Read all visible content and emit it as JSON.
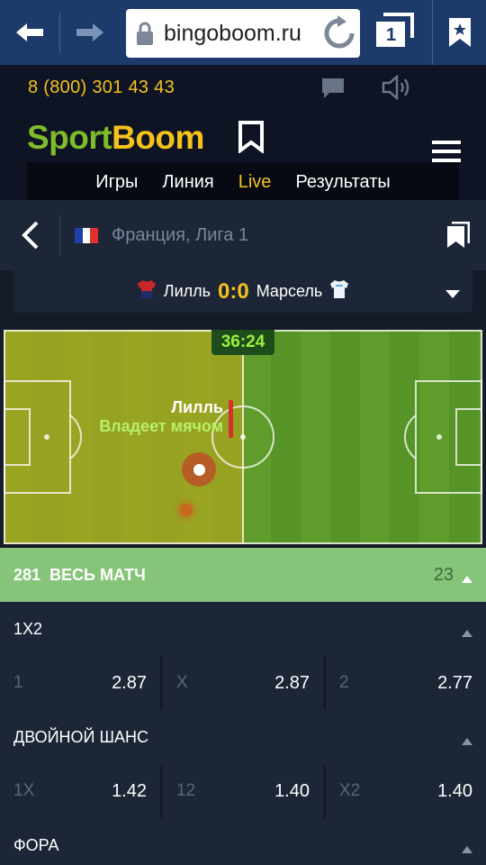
{
  "browser": {
    "url": "bingoboom.ru",
    "tab_count": "1"
  },
  "topbar": {
    "phone": "8 (800) 301 43 43"
  },
  "header": {
    "logo_part1": "Sport",
    "logo_part2": "Boom",
    "nav": [
      "Игры",
      "Линия",
      "Live",
      "Результаты"
    ],
    "active_nav": "Live"
  },
  "league": {
    "name": "Франция, Лига 1",
    "flag_colors": [
      "#1f3fa8",
      "#ffffff",
      "#e0312e"
    ]
  },
  "match": {
    "home_team": "Лилль",
    "away_team": "Марсель",
    "home_score": "0",
    "separator": ":",
    "away_score": "0",
    "time": "36:24",
    "possession_team": "Лилль",
    "possession_text": "Владеет мячом"
  },
  "markets": {
    "number": "281",
    "title": "ВЕСЬ МАТЧ",
    "count": "23",
    "groups": [
      {
        "title": "1X2",
        "odds": [
          {
            "label": "1",
            "value": "2.87"
          },
          {
            "label": "X",
            "value": "2.87"
          },
          {
            "label": "2",
            "value": "2.77"
          }
        ]
      },
      {
        "title": "ДВОЙНОЙ ШАНС",
        "odds": [
          {
            "label": "1X",
            "value": "1.42"
          },
          {
            "label": "12",
            "value": "1.40"
          },
          {
            "label": "X2",
            "value": "1.40"
          }
        ]
      },
      {
        "title": "ФОРА",
        "odds": []
      }
    ]
  },
  "colors": {
    "accent_yellow": "#f5c21b",
    "brand_green": "#7fbc2a",
    "market_header": "#86c47a"
  }
}
